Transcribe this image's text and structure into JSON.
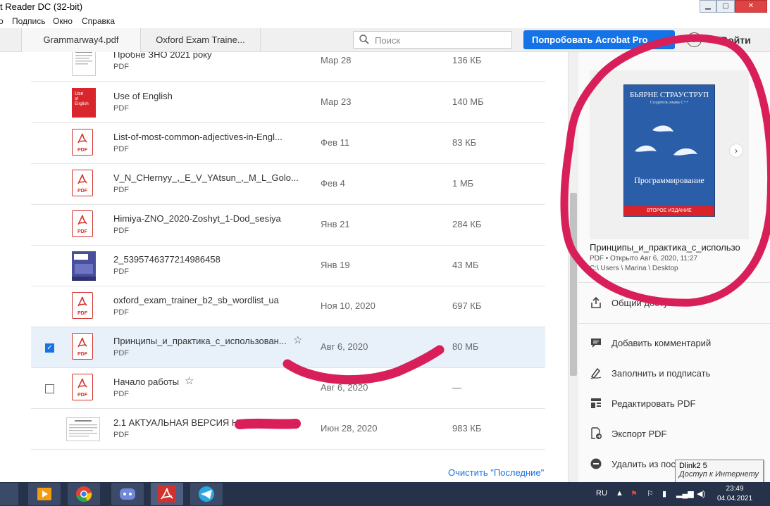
{
  "window": {
    "title": "t Reader DC (32-bit)",
    "minimize": "▁",
    "maximize": "▢",
    "close": "✕"
  },
  "menu": [
    "o",
    "Подпись",
    "Окно",
    "Справка"
  ],
  "tabs": [
    "Grammarway4.pdf",
    "Oxford Exam Traine..."
  ],
  "search": {
    "placeholder": "Поиск"
  },
  "header": {
    "try_button": "Попробовать Acrobat Pro",
    "help": "?",
    "signin": "Войти"
  },
  "files": [
    {
      "name": "Пробне ЗНО 2021 року",
      "type": "PDF",
      "date": "Мар 28",
      "size": "136 КБ",
      "thumb": "doc"
    },
    {
      "name": "Use of English",
      "type": "PDF",
      "date": "Мар 23",
      "size": "140 МБ",
      "thumb": "red-cover"
    },
    {
      "name": "List-of-most-common-adjectives-in-Engl...",
      "type": "PDF",
      "date": "Фев 11",
      "size": "83 КБ",
      "thumb": "pdf"
    },
    {
      "name": "V_N_CHernyy_,_E_V_YAtsun_,_M_L_Golo...",
      "type": "PDF",
      "date": "Фев 4",
      "size": "1 МБ",
      "thumb": "pdf"
    },
    {
      "name": "Himiya-ZNO_2020-Zoshyt_1-Dod_sesiya",
      "type": "PDF",
      "date": "Янв 21",
      "size": "284 КБ",
      "thumb": "pdf"
    },
    {
      "name": "2_5395746377214986458",
      "type": "PDF",
      "date": "Янв 19",
      "size": "43 МБ",
      "thumb": "blue-cover"
    },
    {
      "name": "oxford_exam_trainer_b2_sb_wordlist_ua",
      "type": "PDF",
      "date": "Ноя 10, 2020",
      "size": "697 КБ",
      "thumb": "pdf"
    },
    {
      "name": "Принципы_и_практика_с_использован...",
      "type": "PDF",
      "date": "Авг 6, 2020",
      "size": "80 МБ",
      "thumb": "pdf",
      "selected": true,
      "checked": true,
      "star": "☆"
    },
    {
      "name": "Начало работы",
      "type": "PDF",
      "date": "Авг 6, 2020",
      "size": "—",
      "thumb": "pdf",
      "checkbox": true,
      "star": "☆"
    },
    {
      "name": "2.1 АКТУАЛЬНАЯ ВЕРСИЯ  На",
      "type": "PDF",
      "date": "Июн 28, 2020",
      "size": "983 КБ",
      "thumb": "doc"
    }
  ],
  "pdf_icon_label": "PDF",
  "clear_recent": "Очистить \"Последние\"",
  "preview": {
    "book_author": "БЬЯРНЕ СТРАУСТРУП",
    "book_subtitle": "Создатель языка C++",
    "book_title": "Программирование",
    "book_band": "ВТОРОЕ ИЗДАНИЕ",
    "file_name": "Принципы_и_практика_с_использо",
    "meta": "PDF • Открыто Авг 6, 2020, 11:27",
    "path": "C:\\ Users \\ Marina \\ Desktop"
  },
  "actions": [
    {
      "label": "Общий доступ",
      "icon": "share-icon"
    },
    {
      "label": "Добавить комментарий",
      "icon": "comment-icon"
    },
    {
      "label": "Заполнить и подписать",
      "icon": "sign-icon"
    },
    {
      "label": "Редактировать PDF",
      "icon": "edit-pdf-icon"
    },
    {
      "label": "Экспорт PDF",
      "icon": "export-pdf-icon"
    },
    {
      "label": "Удалить из пос",
      "icon": "remove-icon"
    }
  ],
  "tooltip": {
    "line1": "Dlink2  5",
    "line2": "Доступ к Интернету"
  },
  "taskbar": {
    "lang": "RU",
    "time": "23:49",
    "date": "04.04.2021"
  },
  "colors": {
    "accent": "#1473e6",
    "pdf_red": "#d3322c",
    "marker": "#d91f5a"
  }
}
